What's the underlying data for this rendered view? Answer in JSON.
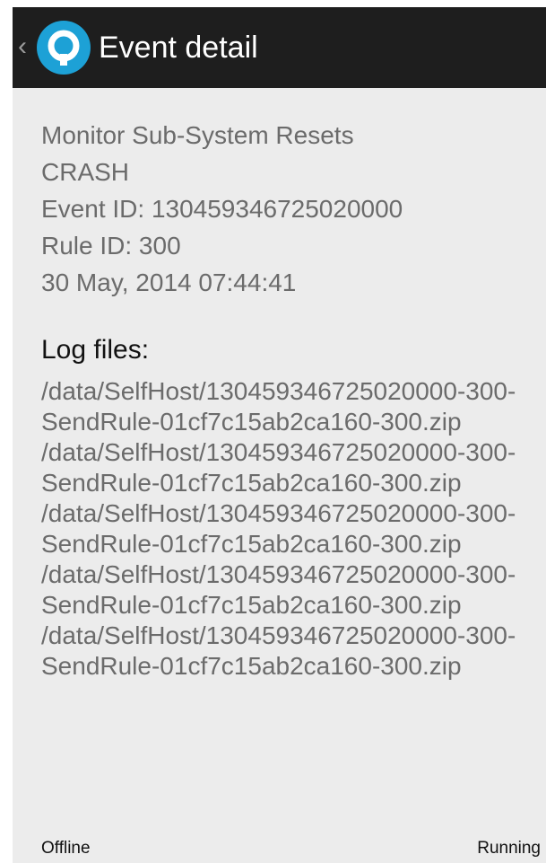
{
  "header": {
    "title": "Event detail",
    "back_icon": "chevron-left-icon",
    "logo_icon": "q-logo-icon",
    "colors": {
      "bar": "#1e1e1e",
      "logo": "#1da1d6"
    }
  },
  "event": {
    "name": "Monitor Sub-System Resets",
    "type": "CRASH",
    "event_id": "Event ID: 130459346725020000",
    "rule_id": "Rule ID: 300",
    "timestamp": "30 May, 2014 07:44:41"
  },
  "log_section": {
    "heading": "Log files:",
    "files": [
      "/data/SelfHost/130459346725020000-300-SendRule-01cf7c15ab2ca160-300.zip",
      "/data/SelfHost/130459346725020000-300-SendRule-01cf7c15ab2ca160-300.zip",
      "/data/SelfHost/130459346725020000-300-SendRule-01cf7c15ab2ca160-300.zip",
      "/data/SelfHost/130459346725020000-300-SendRule-01cf7c15ab2ca160-300.zip",
      "/data/SelfHost/130459346725020000-300-SendRule-01cf7c15ab2ca160-300.zip"
    ]
  },
  "status": {
    "connection": "Offline",
    "state": "Running"
  }
}
